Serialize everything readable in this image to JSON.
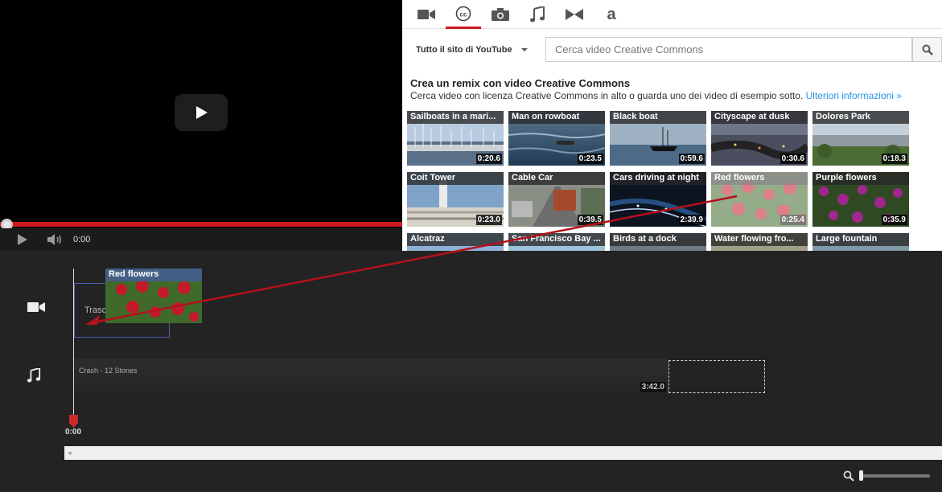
{
  "player": {
    "time": "0:00"
  },
  "tabs": [
    {
      "name": "video",
      "icon": "video-camera-icon"
    },
    {
      "name": "creative-commons",
      "icon": "cc-icon",
      "active": true
    },
    {
      "name": "photos",
      "icon": "camera-icon"
    },
    {
      "name": "audio",
      "icon": "music-note-icon"
    },
    {
      "name": "transitions",
      "icon": "bowtie-transition-icon"
    },
    {
      "name": "text",
      "icon": "text-a-icon"
    }
  ],
  "search": {
    "scope_label": "Tutto il sito di YouTube",
    "placeholder": "Cerca video Creative Commons"
  },
  "intro": {
    "heading": "Crea un remix con video Creative Commons",
    "text": "Cerca video con licenza Creative Commons in alto o guarda uno dei video di esempio sotto. ",
    "link": "Ulteriori informazioni »"
  },
  "videos": [
    {
      "title": "Sailboats in a mari...",
      "duration": "0:20.6"
    },
    {
      "title": "Man on rowboat",
      "duration": "0:23.5"
    },
    {
      "title": "Black boat",
      "duration": "0:59.6"
    },
    {
      "title": "Cityscape at dusk",
      "duration": "0:30.6"
    },
    {
      "title": "Dolores Park",
      "duration": "0:18.3"
    },
    {
      "title": "Coit Tower",
      "duration": "0:23.0"
    },
    {
      "title": "Cable Car",
      "duration": "0:39.5"
    },
    {
      "title": "Cars driving at night",
      "duration": "2:39.9"
    },
    {
      "title": "Red flowers",
      "duration": "0:25.4"
    },
    {
      "title": "Purple flowers",
      "duration": "0:35.9"
    },
    {
      "title": "Alcatraz",
      "duration": ""
    },
    {
      "title": "San Francisco Bay ...",
      "duration": ""
    },
    {
      "title": "Birds at a dock",
      "duration": ""
    },
    {
      "title": "Water flowing fro...",
      "duration": ""
    },
    {
      "title": "Large fountain",
      "duration": ""
    }
  ],
  "timeline": {
    "drop_label": "Trascin",
    "clip_title": "Red flowers",
    "audio_title": "Crash - 12 Stones",
    "audio_duration": "3:42.0",
    "playhead_time": "0:00"
  },
  "colors": {
    "accent": "#cc181e",
    "link": "#2793e6",
    "clip_header": "#455d96"
  }
}
